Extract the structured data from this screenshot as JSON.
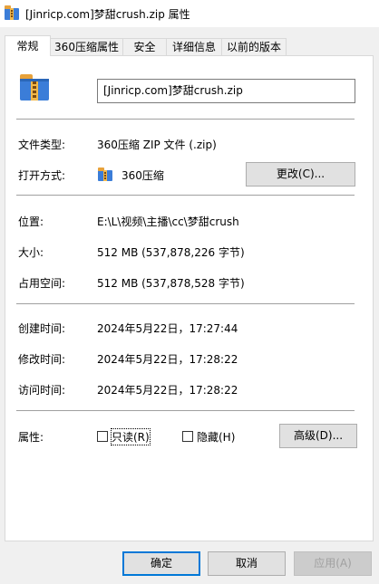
{
  "window": {
    "title": "[Jinricp.com]梦甜crush.zip 属性",
    "icon": "zip-archive-icon"
  },
  "tabs": [
    {
      "label": "常规",
      "active": true
    },
    {
      "label": "360压缩属性",
      "active": false
    },
    {
      "label": "安全",
      "active": false
    },
    {
      "label": "详细信息",
      "active": false
    },
    {
      "label": "以前的版本",
      "active": false
    }
  ],
  "general": {
    "file_name": "[Jinricp.com]梦甜crush.zip",
    "file_type_label": "文件类型:",
    "file_type_value": "360压缩 ZIP 文件 (.zip)",
    "opens_with_label": "打开方式:",
    "opens_with_value": "360压缩",
    "change_button": "更改(C)...",
    "location_label": "位置:",
    "location_value": "E:\\L\\视频\\主播\\cc\\梦甜crush",
    "size_label": "大小:",
    "size_value": "512 MB (537,878,226 字节)",
    "size_on_disk_label": "占用空间:",
    "size_on_disk_value": "512 MB (537,878,528 字节)",
    "created_label": "创建时间:",
    "created_value": "2024年5月22日，17:27:44",
    "modified_label": "修改时间:",
    "modified_value": "2024年5月22日，17:28:22",
    "accessed_label": "访问时间:",
    "accessed_value": "2024年5月22日，17:28:22",
    "attributes_label": "属性:",
    "readonly_label": "只读(R)",
    "readonly_checked": false,
    "hidden_label": "隐藏(H)",
    "hidden_checked": false,
    "advanced_button": "高级(D)..."
  },
  "footer": {
    "ok": "确定",
    "cancel": "取消",
    "apply": "应用(A)"
  },
  "colors": {
    "focus_border": "#0078d7",
    "button_face": "#e1e1e1",
    "disabled_text": "#a0a0a0"
  }
}
